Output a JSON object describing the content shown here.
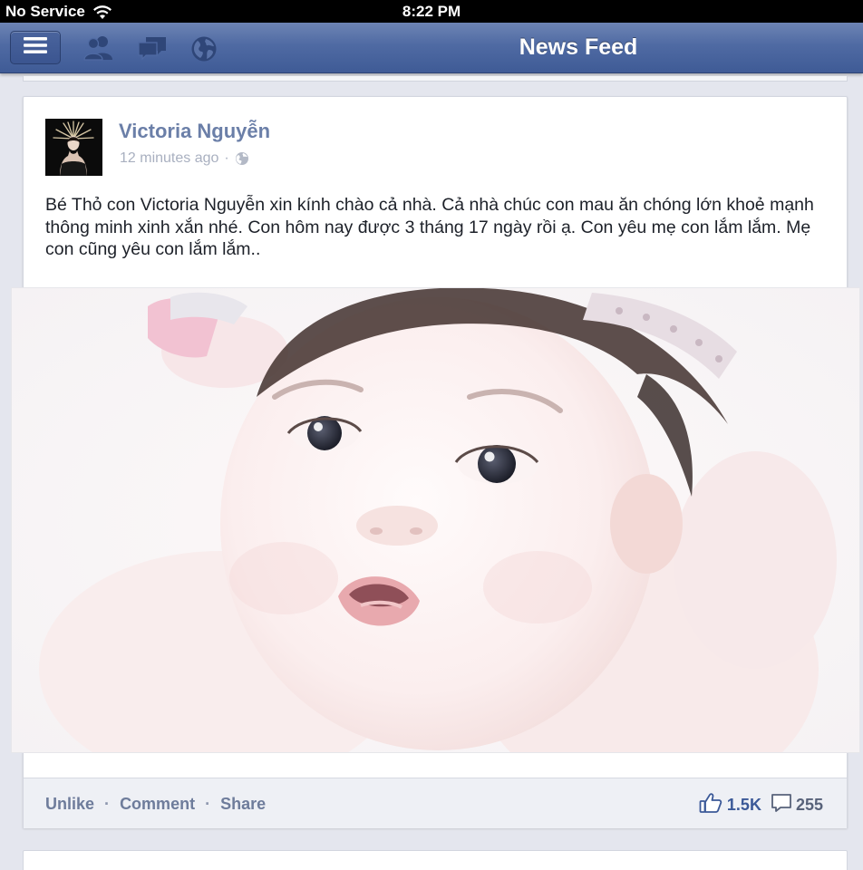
{
  "status_bar": {
    "carrier": "No Service",
    "time": "8:22 PM"
  },
  "nav": {
    "title": "News Feed",
    "icons": [
      "menu-icon",
      "friends-icon",
      "messages-icon",
      "notifications-globe-icon"
    ]
  },
  "story": {
    "author": "Victoria Nguyễn",
    "timestamp": "12 minutes ago",
    "separator": "·",
    "privacy_icon": "globe-icon",
    "text": "Bé Thỏ con Victoria Nguyễn xin kính chào cả nhà. Cả nhà chúc con mau ăn chóng lớn khoẻ mạnh thông minh xinh xắn nhé. Con hôm nay được 3 tháng 17 ngày rồi ạ. Con yêu mẹ con lắm lắm. Mẹ con cũng yêu con lắm lắm..",
    "actions": {
      "unlike": "Unlike",
      "comment": "Comment",
      "share": "Share",
      "separator": "·"
    },
    "like_count": "1.5K",
    "comment_count": "255"
  },
  "colors": {
    "nav_bar": "#4f6aa3",
    "link": "#3b5998",
    "author": "#6b7fa8"
  }
}
